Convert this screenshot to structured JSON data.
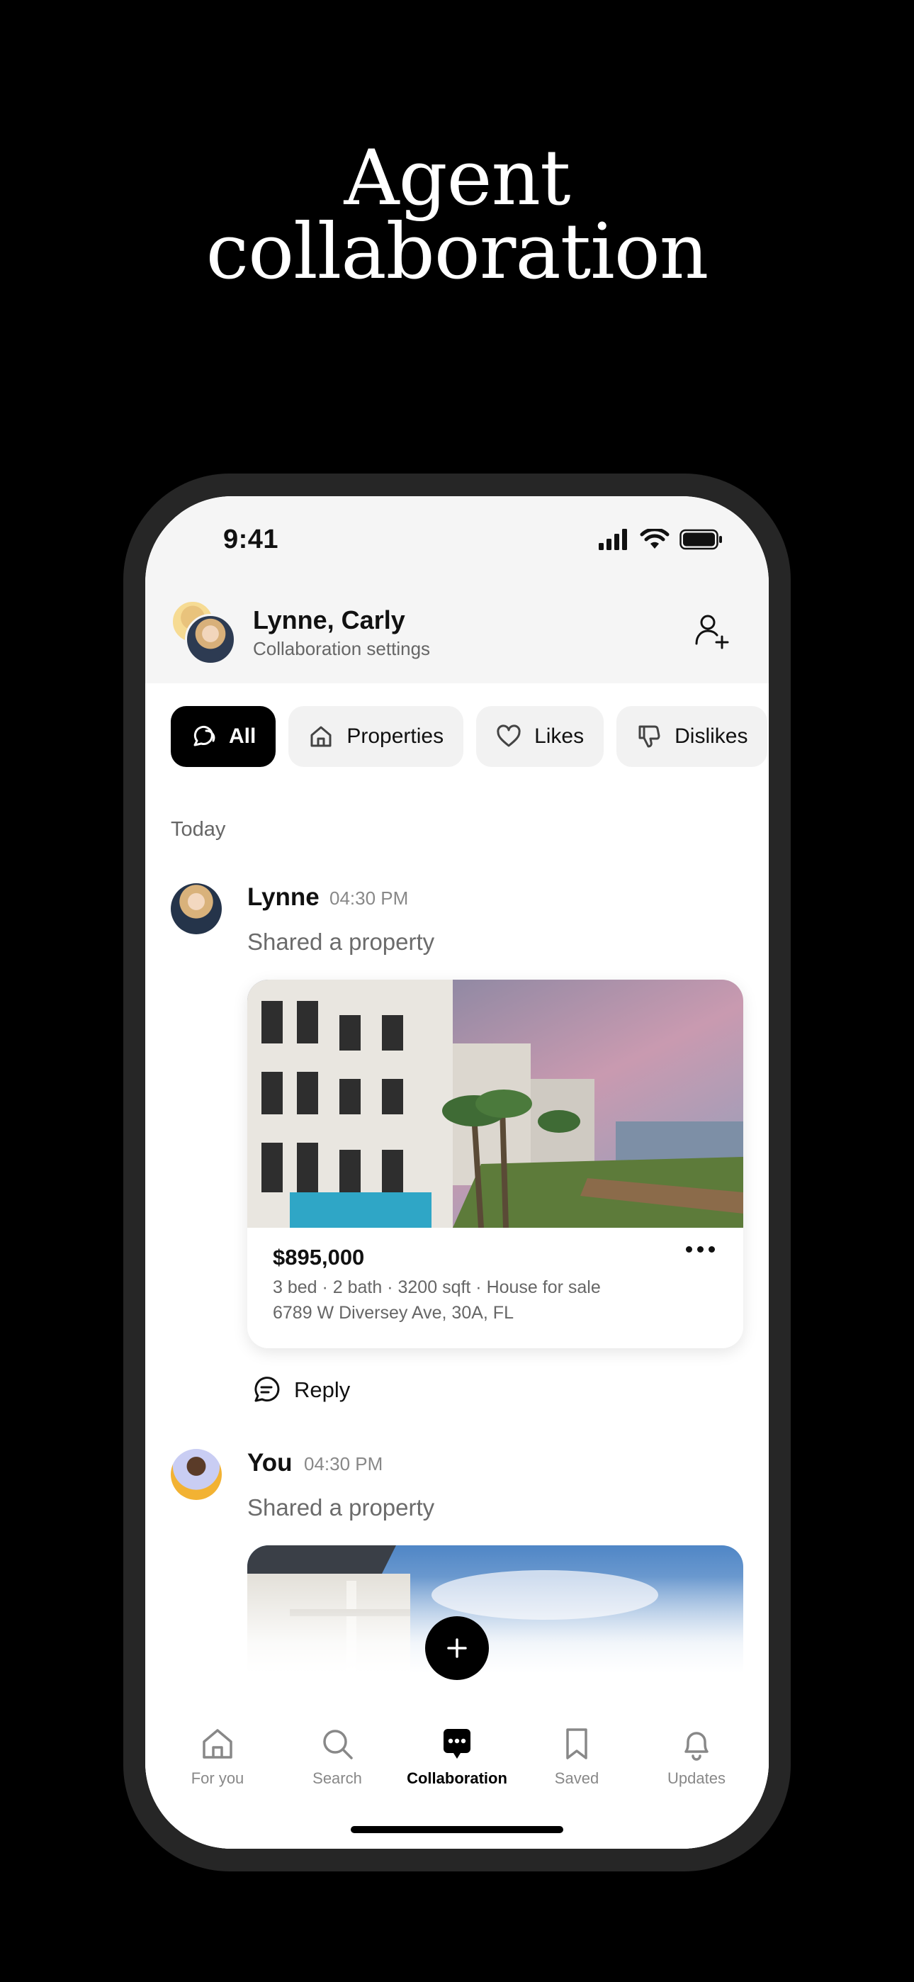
{
  "headline": {
    "line1": "Agent",
    "line2": "collaboration"
  },
  "status_bar": {
    "time": "9:41"
  },
  "header": {
    "name": "Lynne, Carly",
    "subtitle": "Collaboration settings"
  },
  "filters": [
    {
      "label": "All",
      "icon": "chat-bubbles-icon",
      "selected": true
    },
    {
      "label": "Properties",
      "icon": "home-icon",
      "selected": false
    },
    {
      "label": "Likes",
      "icon": "heart-icon",
      "selected": false
    },
    {
      "label": "Dislikes",
      "icon": "thumbs-down-icon",
      "selected": false
    }
  ],
  "feed": {
    "section": "Today",
    "messages": [
      {
        "author": "Lynne",
        "time": "04:30 PM",
        "text": "Shared a property",
        "property": {
          "price": "$895,000",
          "details": "3 bed · 2 bath · 3200 sqft · House for sale",
          "address": "6789 W Diversey Ave, 30A, FL"
        },
        "reply_label": "Reply"
      },
      {
        "author": "You",
        "time": "04:30 PM",
        "text": "Shared a property"
      }
    ]
  },
  "tabbar": [
    {
      "label": "For you",
      "icon": "home-icon",
      "active": false
    },
    {
      "label": "Search",
      "icon": "search-icon",
      "active": false
    },
    {
      "label": "Collaboration",
      "icon": "chat-bubble-icon",
      "active": true
    },
    {
      "label": "Saved",
      "icon": "bookmark-icon",
      "active": false
    },
    {
      "label": "Updates",
      "icon": "bell-icon",
      "active": false
    }
  ],
  "colors": {
    "background": "#000000",
    "accent": "#000000",
    "muted_text": "#666666",
    "chip_bg": "#f2f2f2"
  }
}
